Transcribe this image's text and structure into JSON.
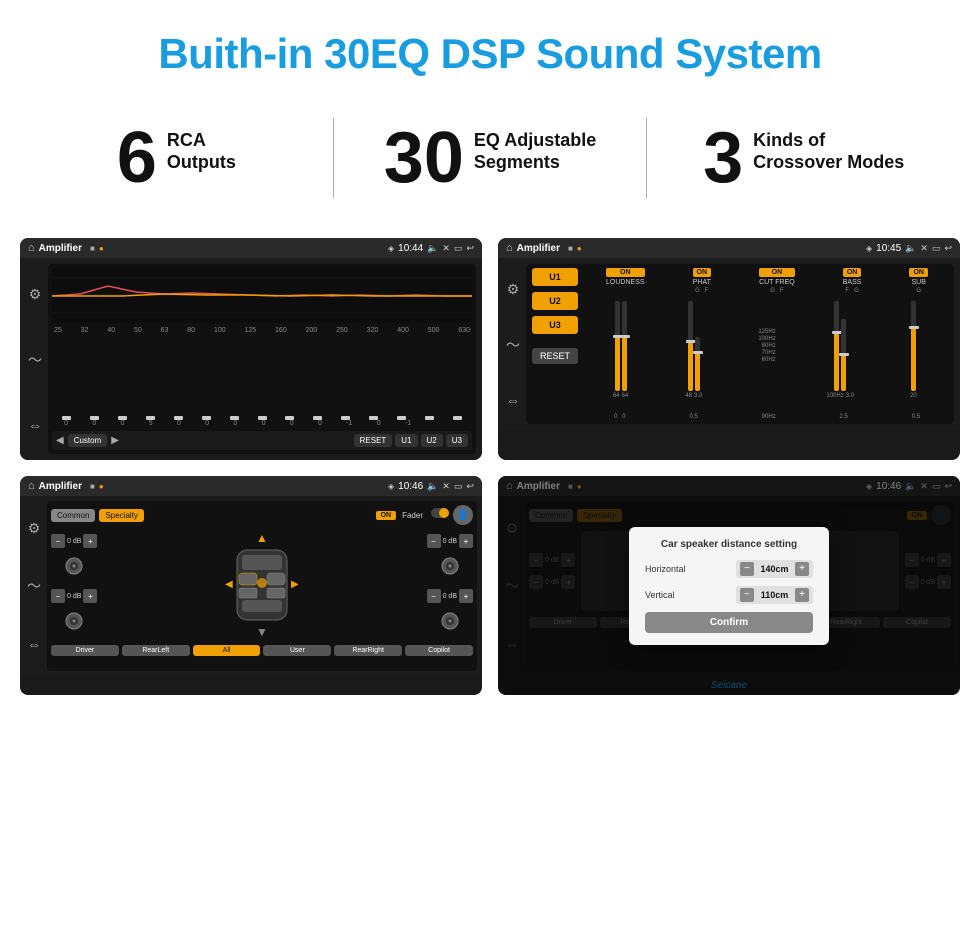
{
  "page": {
    "title": "Buith-in 30EQ DSP Sound System",
    "title_color": "#1a9de0"
  },
  "features": [
    {
      "number": "6",
      "label": "RCA",
      "sublabel": "Outputs"
    },
    {
      "number": "30",
      "label": "EQ Adjustable",
      "sublabel": "Segments"
    },
    {
      "number": "3",
      "label": "Kinds of",
      "sublabel": "Crossover Modes"
    }
  ],
  "screens": {
    "eq": {
      "title": "Amplifier",
      "time": "10:44",
      "freq_labels": [
        "25",
        "32",
        "40",
        "50",
        "63",
        "80",
        "100",
        "125",
        "160",
        "200",
        "250",
        "320",
        "400",
        "500",
        "630"
      ],
      "eq_values": [
        "0",
        "0",
        "0",
        "5",
        "0",
        "0",
        "0",
        "0",
        "0",
        "0",
        "-1",
        "0",
        "-1"
      ],
      "bottom_buttons": [
        "Custom",
        "RESET",
        "U1",
        "U2",
        "U3"
      ]
    },
    "amp": {
      "title": "Amplifier",
      "time": "10:45",
      "presets": [
        "U1",
        "U2",
        "U3"
      ],
      "controls": [
        "LOUDNESS",
        "PHAT",
        "CUT FREQ",
        "BASS",
        "SUB"
      ],
      "reset_label": "RESET"
    },
    "fader": {
      "title": "Amplifier",
      "time": "10:46",
      "tabs": [
        "Common",
        "Specialty"
      ],
      "on_label": "ON",
      "fader_label": "Fader",
      "db_labels": [
        "0 dB",
        "0 dB",
        "0 dB",
        "0 dB"
      ],
      "location_buttons": [
        "Driver",
        "RearLeft",
        "All",
        "User",
        "RearRight",
        "Copilot"
      ]
    },
    "distance": {
      "title": "Amplifier",
      "time": "10:46",
      "tabs": [
        "Common",
        "Specialty"
      ],
      "on_label": "ON",
      "dialog_title": "Car speaker distance setting",
      "horizontal_label": "Horizontal",
      "horizontal_value": "140cm",
      "vertical_label": "Vertical",
      "vertical_value": "110cm",
      "confirm_label": "Confirm",
      "db_labels": [
        "0 dB",
        "0 dB"
      ],
      "location_buttons": [
        "Driver",
        "RearLeft",
        "All",
        "User",
        "RearRight",
        "Copilot"
      ]
    }
  },
  "watermark": "Seicane"
}
